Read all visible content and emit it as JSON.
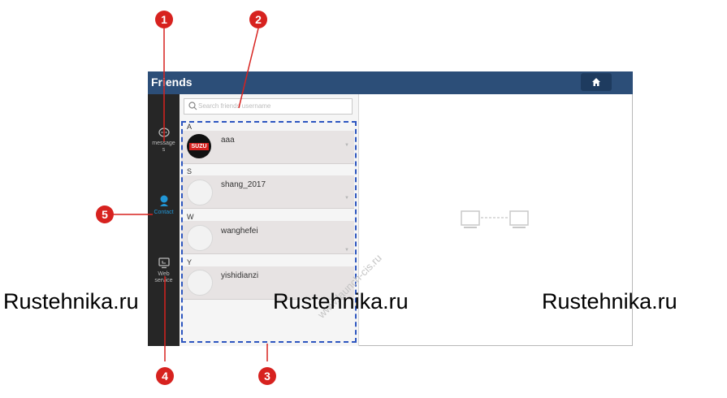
{
  "app": {
    "title": "Friends",
    "home_icon": "home-icon"
  },
  "sidebar": {
    "items": [
      {
        "label": "message",
        "label_line2": "s",
        "icon": "chat-bubble-icon"
      },
      {
        "label": "Contact",
        "icon": "person-icon"
      },
      {
        "label": "Web",
        "label_line2": "service",
        "icon": "monitor-icon"
      }
    ]
  },
  "search": {
    "placeholder": "Search friends username"
  },
  "friends": [
    {
      "letter": "A",
      "name": "aaa",
      "avatar": "SUZU"
    },
    {
      "letter": "S",
      "name": "shang_2017"
    },
    {
      "letter": "W",
      "name": "wanghefei"
    },
    {
      "letter": "Y",
      "name": "yishidianzi"
    }
  ],
  "detail": {
    "empty_icon": "connected-devices-icon"
  },
  "callouts": [
    "1",
    "2",
    "3",
    "4",
    "5"
  ],
  "watermarks": [
    "Rustehnika.ru",
    "Rustehnika.ru",
    "Rustehnika.ru"
  ],
  "url_watermark": "www.launch-cis.ru",
  "colors": {
    "titlebar": "#2c4e78",
    "sidebar": "#262626",
    "accent_contact": "#2196d6",
    "callout": "#d7221f",
    "dashed_box": "#2d56c0"
  }
}
